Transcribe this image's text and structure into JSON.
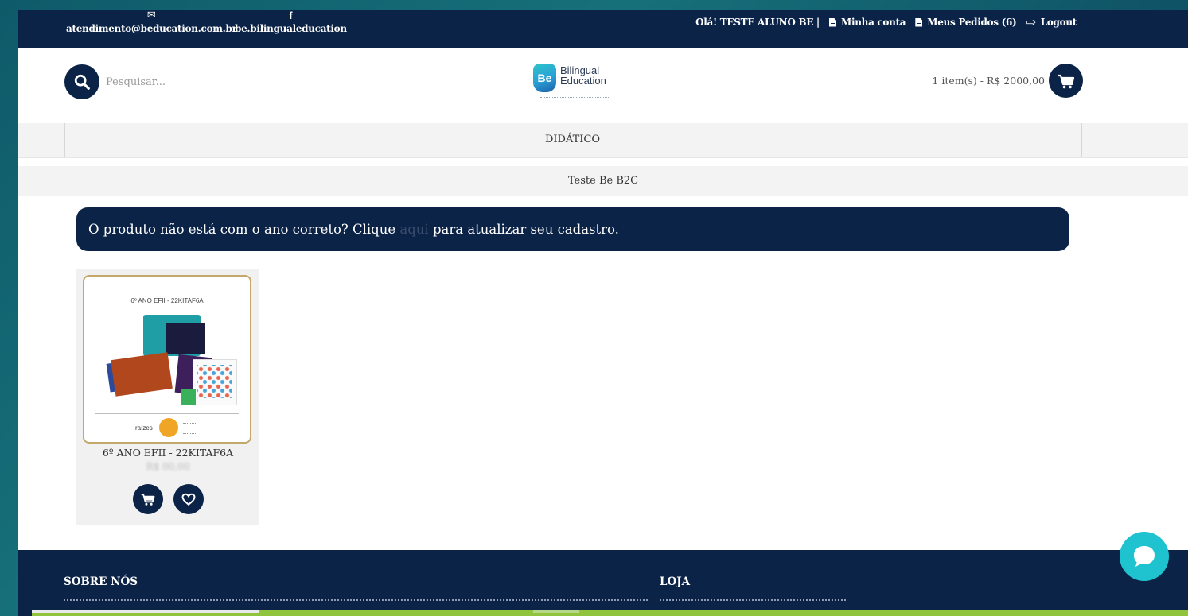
{
  "topbar": {
    "email": "atendimento@beducation.com.br",
    "email_icon": "envelope-icon",
    "facebook": "be.bilingualeducation",
    "facebook_icon": "facebook-icon",
    "greeting": "Olá! TESTE ALUNO BE |",
    "account_label": "Minha conta",
    "orders_label": "Meus Pedidos (6)",
    "logout_label": "Logout"
  },
  "header": {
    "search_placeholder": "Pesquisar...",
    "logo_mark": "Be",
    "logo_line1": "Bilingual",
    "logo_line2": "Education",
    "cart_summary": "1 item(s) - R$ 2000,00"
  },
  "menu": {
    "items": [
      {
        "label": "DIDÁTICO"
      }
    ]
  },
  "breadcrumb": "Teste Be B2C",
  "notice": {
    "before": "O produto não está com o ano correto? Clique ",
    "link": "aqui",
    "after": " para atualizar seu cadastro."
  },
  "products": [
    {
      "image_caption": "6º ANO EFII - 22KITAF6A",
      "brand": "raízes",
      "name": "6º ANO EFII - 22KITAF6A",
      "price": "R$ 00,00"
    }
  ],
  "footer": {
    "col1_title": "SOBRE NÓS",
    "col2_title": "LOJA"
  },
  "colors": {
    "navy": "#0c2348",
    "chat": "#1fc2cf",
    "accent_green": "#8fc43c"
  }
}
